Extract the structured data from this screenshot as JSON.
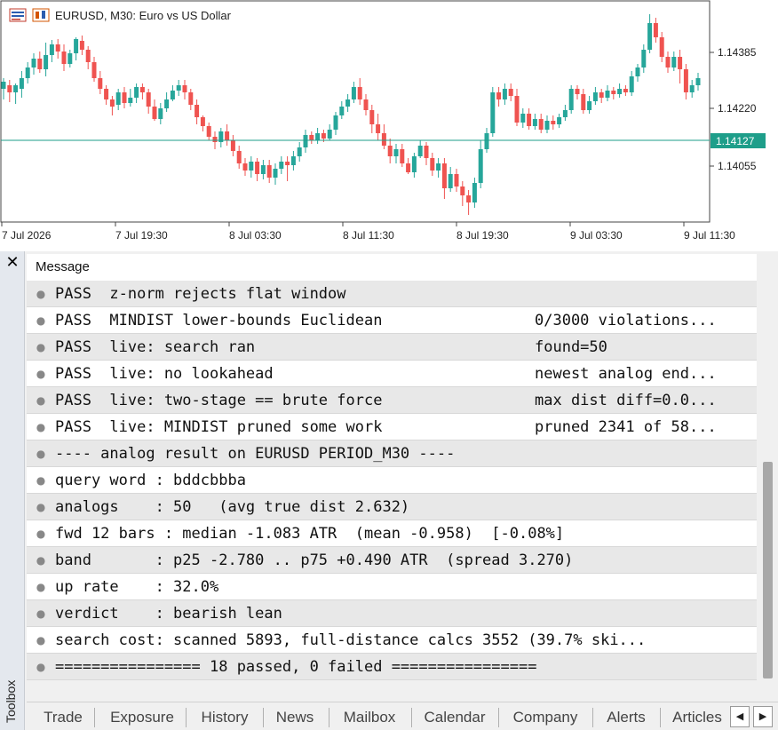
{
  "chart": {
    "symbol_title": "EURUSD, M30:  Euro vs US Dollar",
    "price_labels": [
      "1.14385",
      "1.14220",
      "1.14127",
      "1.14055"
    ],
    "time_labels": [
      "7 Jul 2026",
      "7 Jul 19:30",
      "8 Jul 03:30",
      "8 Jul 11:30",
      "8 Jul 19:30",
      "9 Jul 03:30",
      "9 Jul 11:30"
    ],
    "current_price": "1.14127",
    "colors": {
      "bull": "#26a69a",
      "bear": "#ef5350",
      "price_line": "#1e9e8a"
    }
  },
  "toolbox": {
    "label": "Toolbox",
    "close_icon": "close-icon",
    "column_header": "Message",
    "rows": [
      {
        "text": "PASS  z-norm rejects flat window",
        "extra": ""
      },
      {
        "text": "PASS  MINDIST lower-bounds Euclidean",
        "extra": "0/3000 violations..."
      },
      {
        "text": "PASS  live: search ran",
        "extra": "found=50"
      },
      {
        "text": "PASS  live: no lookahead",
        "extra": "newest analog end..."
      },
      {
        "text": "PASS  live: two-stage == brute force",
        "extra": "max dist diff=0.0..."
      },
      {
        "text": "PASS  live: MINDIST pruned some work",
        "extra": "pruned 2341 of 58..."
      },
      {
        "text": "---- analog result on EURUSD PERIOD_M30 ----",
        "extra": ""
      },
      {
        "text": "query word : bddcbbba",
        "extra": ""
      },
      {
        "text": "analogs    : 50   (avg true dist 2.632)",
        "extra": ""
      },
      {
        "text": "fwd 12 bars : median -1.083 ATR  (mean -0.958)  [-0.08%]",
        "extra": ""
      },
      {
        "text": "band       : p25 -2.780 .. p75 +0.490 ATR  (spread 3.270)",
        "extra": ""
      },
      {
        "text": "up rate    : 32.0%",
        "extra": ""
      },
      {
        "text": "verdict    : bearish lean",
        "extra": ""
      },
      {
        "text": "search cost: scanned 5893, full-distance calcs 3552 (39.7% ski...",
        "extra": ""
      },
      {
        "text": "================ 18 passed, 0 failed ================",
        "extra": ""
      }
    ],
    "tabs": [
      "Trade",
      "Exposure",
      "History",
      "News",
      "Mailbox",
      "Calendar",
      "Company",
      "Alerts",
      "Articles"
    ],
    "scroll_left_icon": "chevron-left-icon",
    "scroll_right_icon": "chevron-right-icon",
    "left_glyph": "◀",
    "right_glyph": "▶",
    "close_glyph": "✕"
  }
}
